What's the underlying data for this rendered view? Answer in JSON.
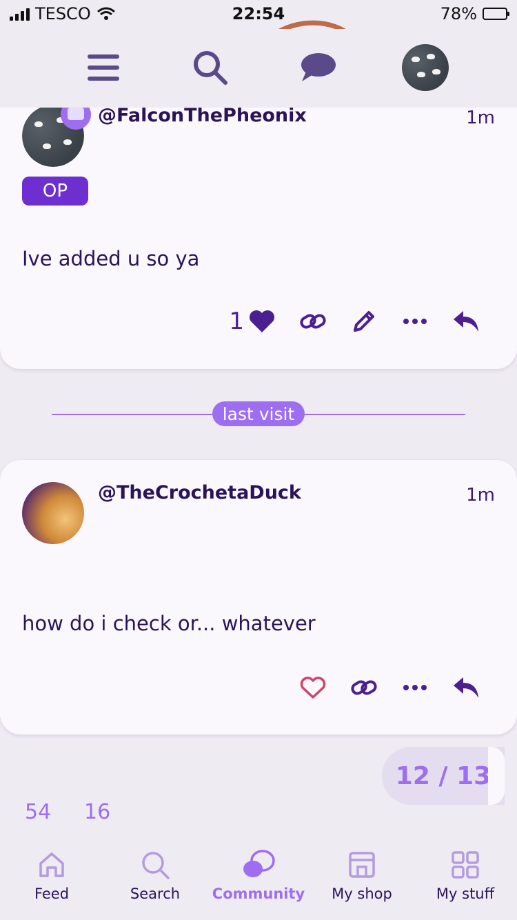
{
  "status_bar": {
    "carrier": "TESCO",
    "time": "22:54",
    "battery": "78%"
  },
  "top_nav": {
    "icons": [
      "hamburger-menu-icon",
      "search-icon",
      "chat-bubble-icon",
      "user-avatar"
    ]
  },
  "posts": [
    {
      "username": "@FalconThePheonix",
      "time": "1m",
      "badge": "OP",
      "body": "Ive added u so ya",
      "likes": "1"
    },
    {
      "username": "@TheCrochetaDuck",
      "time": "1m",
      "body": "how do i check or... whatever"
    }
  ],
  "divider": {
    "label": "last visit"
  },
  "progress": {
    "label": "12 / 13"
  },
  "stats": {
    "left": "54",
    "right": "16"
  },
  "tabs": [
    {
      "label": "Feed"
    },
    {
      "label": "Search"
    },
    {
      "label": "Community"
    },
    {
      "label": "My shop"
    },
    {
      "label": "My stuff"
    }
  ],
  "colors": {
    "accent": "#9d6ef0",
    "badge": "#6e2fd0",
    "text": "#2b1358",
    "heart": "#d1436b"
  }
}
